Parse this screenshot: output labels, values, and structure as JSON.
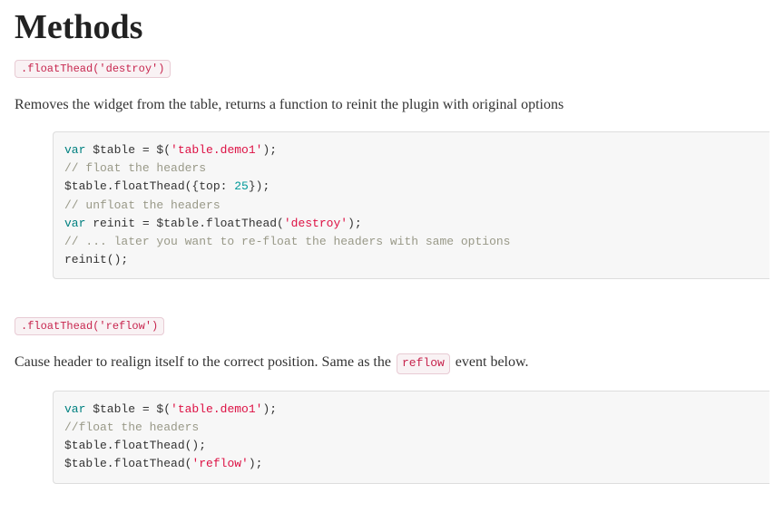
{
  "heading": "Methods",
  "sections": [
    {
      "label": ".floatThead('destroy')",
      "desc_parts": [
        {
          "t": "text",
          "v": "Removes the widget from the table, returns a function to reinit the plugin with original options"
        }
      ],
      "code": [
        [
          {
            "c": "kw",
            "v": "var"
          },
          {
            "c": "pln",
            "v": " $table = $("
          },
          {
            "c": "str",
            "v": "'table.demo1'"
          },
          {
            "c": "pln",
            "v": ");"
          }
        ],
        [
          {
            "c": "com",
            "v": "// float the headers"
          }
        ],
        [
          {
            "c": "pln",
            "v": "$table.floatThead({"
          },
          {
            "c": "key",
            "v": "top"
          },
          {
            "c": "pln",
            "v": ": "
          },
          {
            "c": "num",
            "v": "25"
          },
          {
            "c": "pln",
            "v": "});"
          }
        ],
        [
          {
            "c": "com",
            "v": "// unfloat the headers"
          }
        ],
        [
          {
            "c": "kw",
            "v": "var"
          },
          {
            "c": "pln",
            "v": " reinit = $table.floatThead("
          },
          {
            "c": "str",
            "v": "'destroy'"
          },
          {
            "c": "pln",
            "v": ");"
          }
        ],
        [
          {
            "c": "com",
            "v": "// ... later you want to re-float the headers with same options"
          }
        ],
        [
          {
            "c": "pln",
            "v": "reinit();"
          }
        ]
      ]
    },
    {
      "label": ".floatThead('reflow')",
      "desc_parts": [
        {
          "t": "text",
          "v": "Cause header to realign itself to the correct position. Same as the "
        },
        {
          "t": "code",
          "v": "reflow"
        },
        {
          "t": "text",
          "v": " event below."
        }
      ],
      "code": [
        [
          {
            "c": "kw",
            "v": "var"
          },
          {
            "c": "pln",
            "v": " $table = $("
          },
          {
            "c": "str",
            "v": "'table.demo1'"
          },
          {
            "c": "pln",
            "v": ");"
          }
        ],
        [
          {
            "c": "com",
            "v": "//float the headers"
          }
        ],
        [
          {
            "c": "pln",
            "v": "$table.floatThead();"
          }
        ],
        [
          {
            "c": "pln",
            "v": "$table.floatThead("
          },
          {
            "c": "str",
            "v": "'reflow'"
          },
          {
            "c": "pln",
            "v": ");"
          }
        ]
      ]
    }
  ]
}
